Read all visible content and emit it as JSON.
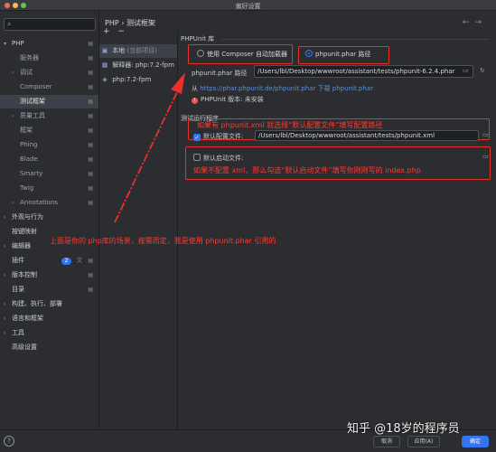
{
  "window": {
    "title": "偏好设置"
  },
  "search": {
    "icon": "search-icon"
  },
  "sidebar": {
    "items": [
      {
        "label": "PHP",
        "expanded": true
      },
      {
        "label": "服务器"
      },
      {
        "label": "调试"
      },
      {
        "label": "Composer"
      },
      {
        "label": "测试框架",
        "selected": true
      },
      {
        "label": "质量工具"
      },
      {
        "label": "框架"
      },
      {
        "label": "Phing"
      },
      {
        "label": "Blade"
      },
      {
        "label": "Smarty"
      },
      {
        "label": "Twig"
      },
      {
        "label": "Annotations"
      },
      {
        "label": "外观与行为"
      },
      {
        "label": "按键映射"
      },
      {
        "label": "编辑器"
      },
      {
        "label": "插件",
        "badge": "2"
      },
      {
        "label": "版本控制"
      },
      {
        "label": "目录"
      },
      {
        "label": "构建、执行、部署"
      },
      {
        "label": "语言和框架"
      },
      {
        "label": "工具"
      },
      {
        "label": "高级设置"
      }
    ]
  },
  "breadcrumb": {
    "parent": "PHP",
    "separator": "›",
    "current": "测试框架"
  },
  "interpreters": {
    "toolbar": {
      "add": "+",
      "remove": "−"
    },
    "items": [
      {
        "label": "本地",
        "hint": "(当前项目)"
      },
      {
        "label": "解释器: php:7.2-fpm"
      },
      {
        "label": "php:7.2-fpm"
      }
    ]
  },
  "phpunit": {
    "section_title": "PHPUnit 库",
    "radio_composer": "使用 Composer 自动加载器",
    "radio_phar": "phpunit.phar 路径",
    "phar_label": "phpunit.phar 路径",
    "phar_path": "/Users/lbl/Desktop/wwwroot/assistant/tests/phpunit-6.2.4.phar",
    "download_prefix": "从",
    "download_url": "https://phar.phpunit.de/phpunit.phar",
    "download_suffix": "下载 phpunit.phar",
    "version_warning": "PHPUnit 版本: 未安装"
  },
  "run_options": {
    "section_title": "测试运行程序",
    "default_config_label": "默认配置文件:",
    "default_config_path": "/Users/lbl/Desktop/wwwroot/assistant/tests/phpunit.xml",
    "default_bootstrap_label": "默认启动文件:"
  },
  "annotations": {
    "config_note": "如果有 phpunit.xml 就选择“默认配置文件”填写配置路径",
    "bootstrap_note": "如果不配置 xml，那么勾选“默认启动文件”填写你刚刚写的 index.php",
    "left_note": "上面是你的 php库的场景，按需而定，我是使用 phpunit.phar 引用的",
    "color": "#e8322a"
  },
  "footer": {
    "help": "?",
    "cancel": "取消",
    "apply": "应用(A)",
    "ok": "确定"
  },
  "watermark": "知乎 @18岁的程序员",
  "colors": {
    "accent": "#3574f0",
    "background": "#2b2d30",
    "annotation": "#e8322a"
  }
}
